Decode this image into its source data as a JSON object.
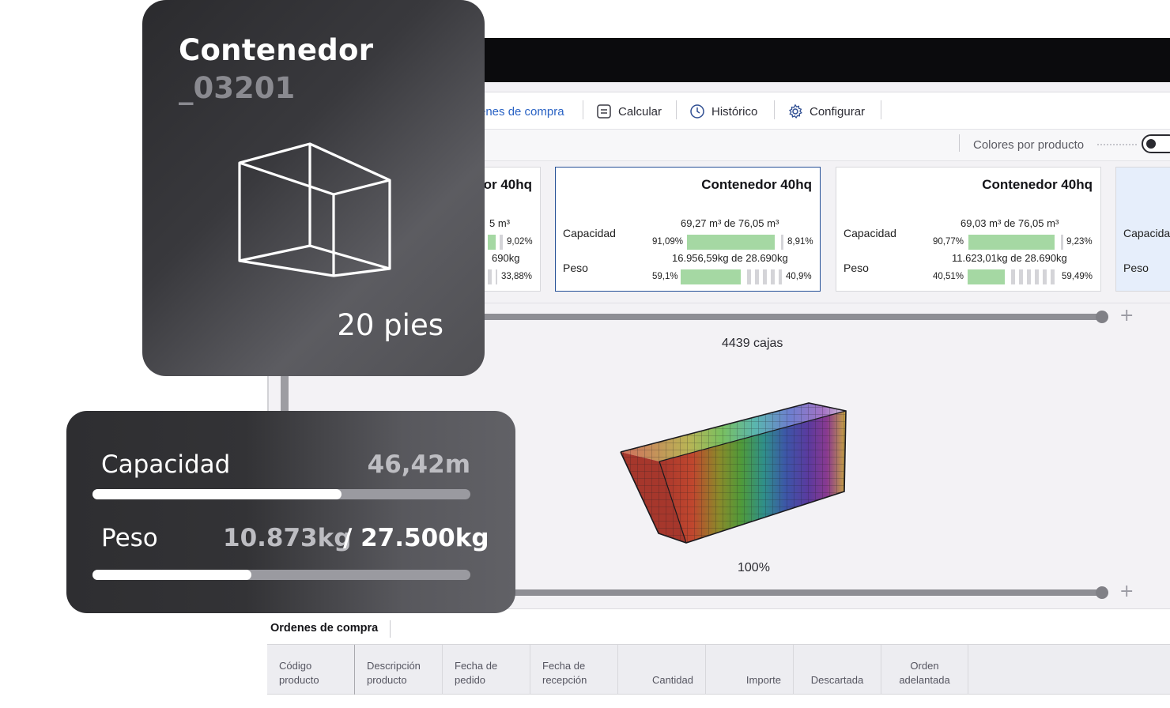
{
  "overlay_card": {
    "title": "Contenedor",
    "code": "_03201",
    "size": "20 pies"
  },
  "overlay_stats": {
    "capacity_label": "Capacidad",
    "capacity_value": "46,42m",
    "capacity_fraction": 0.66,
    "weight_label": "Peso",
    "weight_value": "10.873kg",
    "weight_total": "/ 27.500kg",
    "weight_fraction": 0.42
  },
  "tabs": [
    {
      "label": "enes de compra",
      "icon": "list-icon"
    },
    {
      "label": "Calcular",
      "icon": "calculator-icon"
    },
    {
      "label": "Histórico",
      "icon": "clock-icon"
    },
    {
      "label": "Configurar",
      "icon": "gear-icon"
    }
  ],
  "toolbar": {
    "colors_label": "Colores por producto",
    "colors_toggle_on": false
  },
  "containers": [
    {
      "title": "or 40hq",
      "capacity_text": "5 m³",
      "capacity_pct_right": "9,02%",
      "weight_text": "690kg",
      "weight_pct_right": "33,88%"
    },
    {
      "title": "Contenedor 40hq",
      "capacity_label": "Capacidad",
      "capacity_text": "69,27 m³ de 76,05 m³",
      "capacity_pct_left": "91,09%",
      "capacity_pct_right": "8,91%",
      "capacity_fraction": 0.9109,
      "weight_label": "Peso",
      "weight_text": "16.956,59kg de 28.690kg",
      "weight_pct_left": "59,1%",
      "weight_pct_right": "40,9%",
      "weight_fraction": 0.591,
      "selected": true
    },
    {
      "title": "Contenedor 40hq",
      "capacity_label": "Capacidad",
      "capacity_text": "69,03 m³ de 76,05 m³",
      "capacity_pct_left": "90,77%",
      "capacity_pct_right": "9,23%",
      "capacity_fraction": 0.9077,
      "weight_label": "Peso",
      "weight_text": "11.623,01kg de 28.690kg",
      "weight_pct_left": "40,51%",
      "weight_pct_right": "59,49%",
      "weight_fraction": 0.4051
    },
    {
      "capacity_label": "Capacida",
      "weight_label": "Peso"
    }
  ],
  "boxes_caption": "4439 cajas",
  "fill_caption": "100%",
  "orders": {
    "title": "Ordenes de compra",
    "columns": [
      [
        "Código",
        "producto"
      ],
      [
        "Descripción",
        "producto"
      ],
      [
        "Fecha de",
        "pedido"
      ],
      [
        "Fecha de",
        "recepción"
      ],
      [
        "",
        "Cantidad"
      ],
      [
        "",
        "Importe"
      ],
      [
        "",
        "Descartada"
      ],
      [
        "Orden",
        "adelantada"
      ]
    ]
  },
  "colors": {
    "accent_blue": "#2962c4",
    "bar_green": "#a5d8a3",
    "selected_border": "#244f96"
  }
}
